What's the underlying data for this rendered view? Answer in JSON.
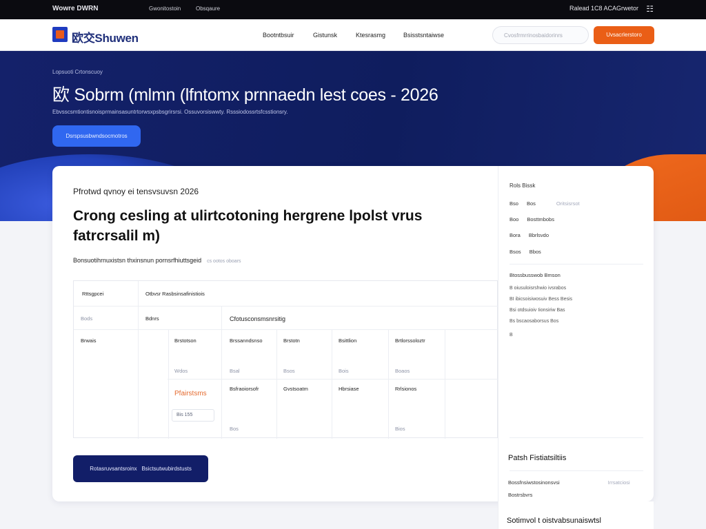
{
  "topbar": {
    "brand": "Wowre DWRN",
    "links": [
      "Gwonitostoin",
      "Obsqaure"
    ],
    "right_text": "Ralead 1C8 ACAGrwetor",
    "globe_icon": "globe-icon"
  },
  "navbar": {
    "logo_text": "欧交Shuwen",
    "items": [
      "Bootntbsuir",
      "Gistunsk",
      "Ktesrasmg",
      "Bsisstsntaiwse"
    ],
    "search_placeholder": "Cvosfrmrrinosbaidorinrs",
    "cta_label": "Uvsacrlerstoro"
  },
  "hero": {
    "breadcrumb": "Lopsuoti Crtonscuoy",
    "title": "欧 Sobrm (mlmn (lfntomx prnnaedn lest coes - 2026",
    "subtitle": "Ebvsscsmtiontisnoisprmainsasuntrtorwsxpsbsgrirsrsi. Ossuvorsiswwty. Rsssiodossrtsfcsstionsry.",
    "button_label": "Dsrspsusbwndsocmotros"
  },
  "card": {
    "eyebrow": "Pfrotwd qvnoy ei tensvsuvsn 2026",
    "heading": "Crong cesling at ulirtcotoning hergrene lpolst vrus fatrcrsalil m)",
    "meta": "Bonsuotihrnuxistsn thxinsnun pornsrfhiuttsgeid",
    "meta_note": "cs ootos oboars",
    "button_left": "Rotasruvsantsroinx",
    "button_right": "Bsictsutwubirdstusts"
  },
  "table": {
    "headers": [
      "Rttsgpcei",
      "Otbvsr Rasbsinsafinistiois"
    ],
    "row_labels": [
      "Bods",
      "Brwais"
    ],
    "group_cell": "Bdnrs",
    "group_header": "Cfotusconsmsnrsitig",
    "columns": [
      "Brstotson",
      "Brssanndsnso",
      "Brstotn",
      "Bsittlion",
      "Brtlorssoloztr"
    ],
    "col_sub": [
      "Wdos",
      "Bsal",
      "Bsos",
      "Bois",
      "Boaos"
    ],
    "row2": [
      "Bsfraoiorsofr",
      "Gvstsoatm",
      "Hbrsiase",
      "Rrlsionos"
    ],
    "accent_label": "Pfairstsms",
    "chip": "Bis 155",
    "bottom_cells": [
      "Bos",
      "Bios"
    ]
  },
  "side": {
    "title": "Rols Bissk",
    "rows": [
      {
        "k": "Bso",
        "v": "Bos",
        "t": "Oritsisrsot"
      },
      {
        "k": "Boo",
        "v": "Bosttmbobs",
        "t": ""
      },
      {
        "k": "Bora",
        "v": "Bbrlsvdo",
        "t": ""
      },
      {
        "k": "Bsos",
        "v": "Bbos",
        "t": ""
      }
    ],
    "list_head": "Btossbusswob  Bmson",
    "list": [
      "B  oiusuloisrshwio ivsrabos",
      "BI  ibicsoisiwosuiv Bess Besis",
      "Bsi  otdsuioiv Iionsiriw  Bas",
      "Bs  bscaosaborsus  Bos",
      "B"
    ],
    "sub_title": "Patsh Fistiatsiltiis",
    "sub_rows": [
      {
        "a": "Bossfnsiwstosinonsvsi",
        "b": "Irrsatciosi"
      },
      {
        "a": "Bostrsbvrs",
        "b": ""
      }
    ],
    "footer": "Sotimvol t oistvabsunaiswtsl"
  }
}
